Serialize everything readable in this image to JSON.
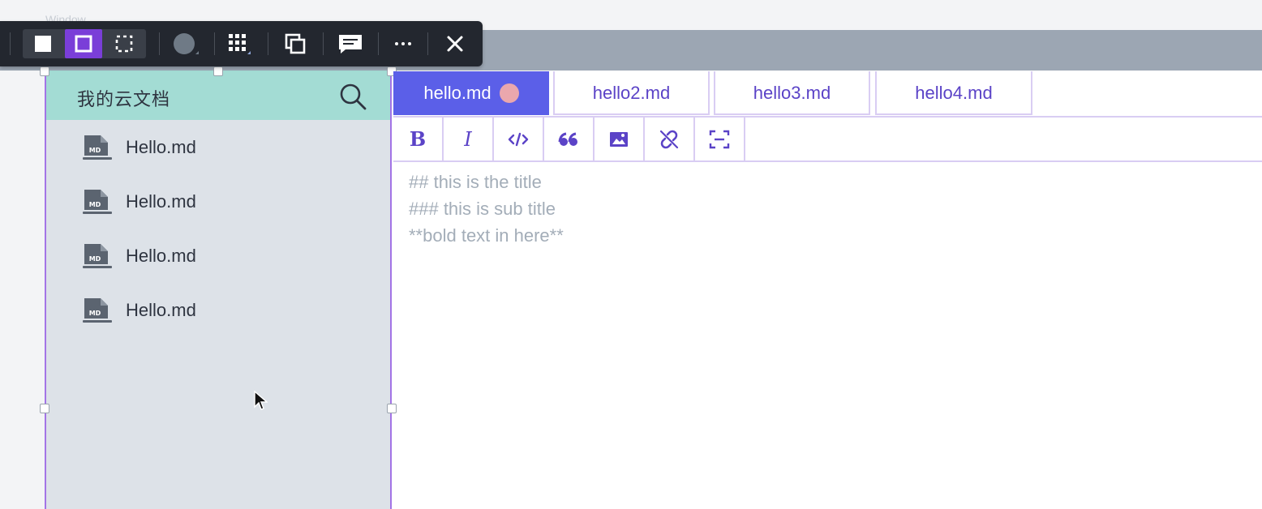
{
  "window": {
    "title": "Window"
  },
  "sidebar": {
    "title": "我的云文档",
    "files": [
      {
        "name": "Hello.md",
        "icon": "markdown-file-icon",
        "badge": "MD"
      },
      {
        "name": "Hello.md",
        "icon": "markdown-file-icon",
        "badge": "MD"
      },
      {
        "name": "Hello.md",
        "icon": "markdown-file-icon",
        "badge": "MD"
      },
      {
        "name": "Hello.md",
        "icon": "markdown-file-icon",
        "badge": "MD"
      }
    ]
  },
  "tabs": [
    {
      "label": "hello.md",
      "active": true,
      "unsaved": true
    },
    {
      "label": "hello2.md",
      "active": false
    },
    {
      "label": "hello3.md",
      "active": false
    },
    {
      "label": "hello4.md",
      "active": false
    }
  ],
  "md_toolbar": [
    "bold-icon",
    "italic-icon",
    "code-icon",
    "quote-icon",
    "image-icon",
    "unlink-icon",
    "fullscreen-icon"
  ],
  "editor": {
    "lines": [
      "## this is the title",
      "### this is sub title",
      "**bold text in here**"
    ]
  },
  "float_toolbar": [
    "fill-icon",
    "outline-icon",
    "dashed-outline-icon",
    "color-picker-icon",
    "grid-icon",
    "duplicate-icon",
    "comment-icon",
    "more-icon",
    "close-icon"
  ],
  "colors": {
    "accent": "#5b5fe8",
    "tab_text": "#5b43c7",
    "sidebar_header": "#a3dcd4",
    "sidebar_bg": "#dde2e8",
    "selection_border": "#a374e6",
    "unsaved_dot": "#eaa7ad",
    "toolbar_active": "#7a3ed8"
  }
}
